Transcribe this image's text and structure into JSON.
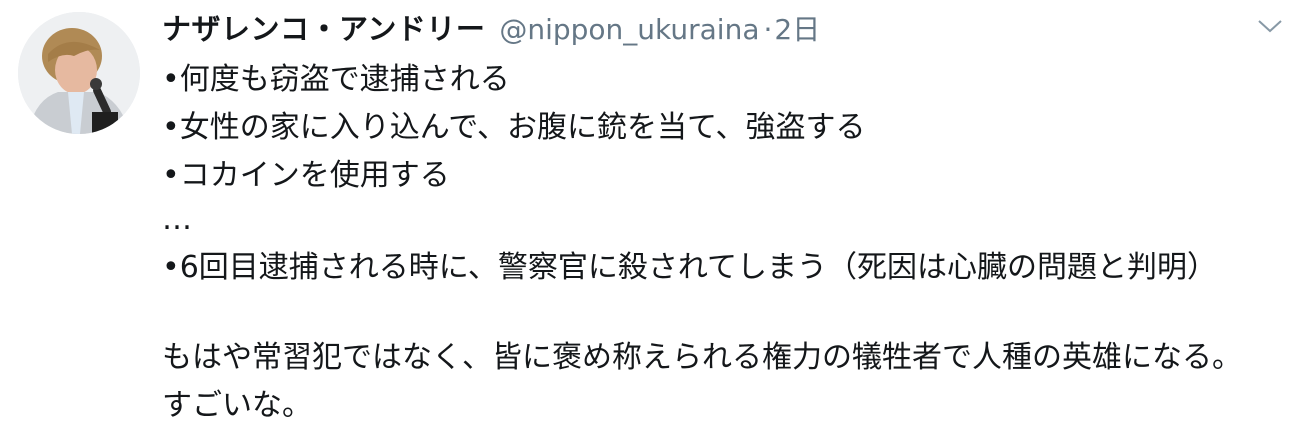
{
  "tweet": {
    "author": {
      "display_name": "ナザレンコ・アンドリー",
      "handle": "@nippon_ukuraina",
      "separator": "·",
      "timestamp": "2日",
      "avatar_icon": "profile-photo-avatar"
    },
    "menu_icon": "chevron-down-icon",
    "body": {
      "lines": [
        "•何度も窃盗で逮捕される",
        "•女性の家に入り込んで、お腹に銃を当て、強盗する",
        "•コカインを使用する",
        "…",
        "•6回目逮捕される時に、警察官に殺されてしまう（死因は心臓の問題と判明）"
      ],
      "paragraph": "もはや常習犯ではなく、皆に褒め称えられる権力の犠牲者で人種の英雄になる。すごいな。"
    },
    "colors": {
      "text_primary": "#14171a",
      "text_secondary": "#657786",
      "background": "#ffffff"
    }
  }
}
